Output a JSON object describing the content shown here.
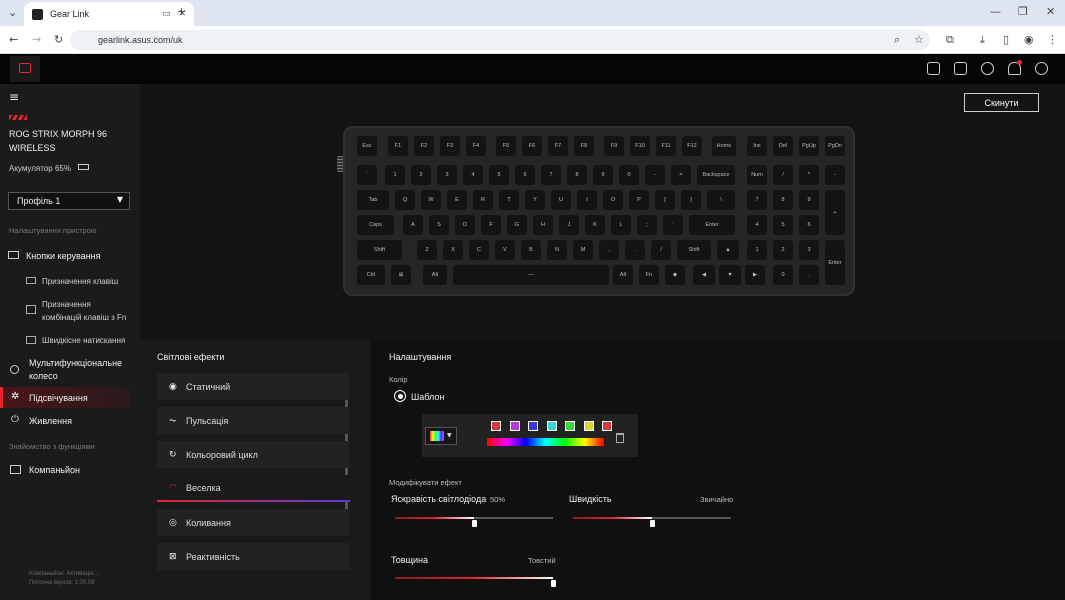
{
  "browser": {
    "tab_title": "Gear Link",
    "url": "gearlink.asus.com/uk"
  },
  "device": {
    "name_line1": "ROG STRIX MORPH 96",
    "name_line2": "WIRELESS",
    "battery": "Акумулятор 65%"
  },
  "profile": {
    "selected": "Профіль 1"
  },
  "sidebar": {
    "section_device": "Налаштування пристрою",
    "controls": "Кнопки керування",
    "assign_keys": "Призначення клавіш",
    "fn_combo": "Призначення комбінацій клавіш з Fn",
    "quick_press": "Швидкісне натискання",
    "wheel": "Мультифункціональне колесо",
    "lighting": "Підсвічування",
    "power": "Живлення",
    "section_features": "Знайомство з функціями",
    "companion": "Компаньйон",
    "footer1": "Компаньйон: Активація...",
    "footer2": "Поточна версія: 1.00.08"
  },
  "reset_label": "Скинути",
  "keys": {
    "row0": [
      "Esc",
      "F1",
      "F2",
      "F3",
      "F4",
      "F5",
      "F6",
      "F7",
      "F8",
      "F9",
      "F10",
      "F11",
      "F12",
      "Home",
      "Ins",
      "Del",
      "PgUp",
      "PgDn"
    ],
    "row1": [
      "`",
      "1",
      "2",
      "3",
      "4",
      "5",
      "6",
      "7",
      "8",
      "9",
      "0",
      "-",
      "=",
      "Backspace",
      "Num",
      "/",
      "*",
      "-"
    ],
    "row2": [
      "Tab",
      "Q",
      "W",
      "E",
      "R",
      "T",
      "Y",
      "U",
      "I",
      "O",
      "P",
      "[",
      "]",
      "\\",
      "7",
      "8",
      "9",
      "+"
    ],
    "row3": [
      "Caps",
      "A",
      "S",
      "D",
      "F",
      "G",
      "H",
      "J",
      "K",
      "L",
      ";",
      "'",
      "Enter",
      "4",
      "5",
      "6"
    ],
    "row4": [
      "Shift",
      "Z",
      "X",
      "C",
      "V",
      "B",
      "N",
      "M",
      ",",
      ".",
      "/",
      "Shift",
      "▲",
      "1",
      "2",
      "3",
      "Enter"
    ],
    "row5": [
      "Ctrl",
      "⊞",
      "Alt",
      "—",
      "Alt",
      "Fn",
      "◆",
      "◀",
      "▼",
      "▶",
      "0",
      "."
    ]
  },
  "effects": {
    "title": "Світлові ефекти",
    "items": [
      {
        "label": "Статичний",
        "icon": "radio-icon"
      },
      {
        "label": "Пульсація",
        "icon": "pulse-icon"
      },
      {
        "label": "Кольоровий цикл",
        "icon": "cycle-icon"
      },
      {
        "label": "Веселка",
        "icon": "rainbow-icon"
      },
      {
        "label": "Коливання",
        "icon": "wave-icon"
      },
      {
        "label": "Реактивність",
        "icon": "reactive-icon"
      }
    ],
    "selected": "Веселка"
  },
  "settings": {
    "title": "Налаштування",
    "color_label": "Колір",
    "template_label": "Шаблон",
    "swatches": [
      "#d63a3a",
      "#b63ad6",
      "#3a3ad6",
      "#3ad6d6",
      "#3ad63a",
      "#d6d63a",
      "#d63a3a"
    ],
    "modify_label": "Модифікувати ефект",
    "brightness_label": "Яскравість світлодіода",
    "brightness_value": "50%",
    "brightness": 0.5,
    "speed_label": "Швидкість",
    "speed_value": "Звичайно",
    "speed": 0.5,
    "thickness_label": "Товщина",
    "thickness_value": "Товстий",
    "thickness": 1.0
  }
}
